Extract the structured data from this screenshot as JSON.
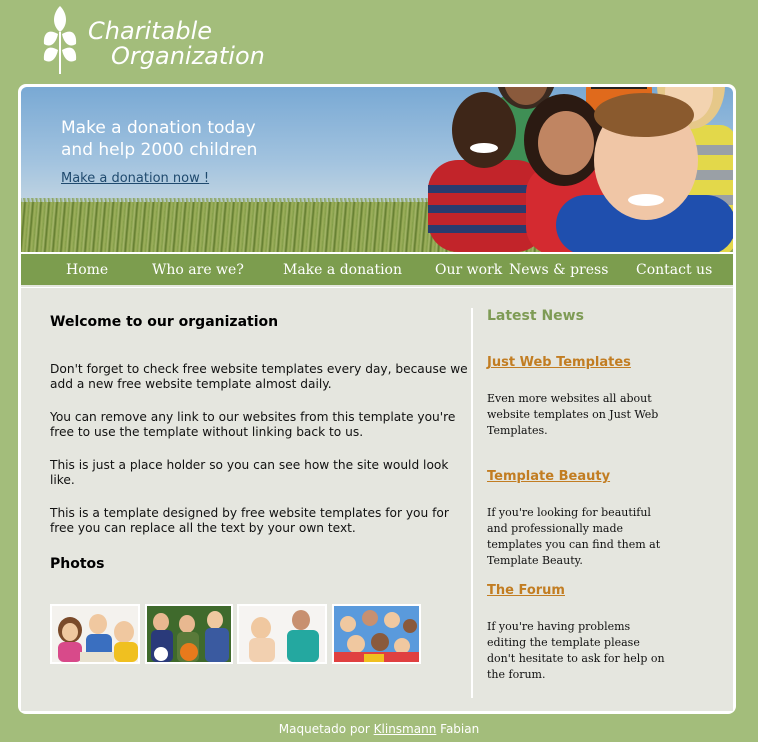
{
  "logo": {
    "line1": "Charitable",
    "line2": "Organization"
  },
  "banner": {
    "tagline_line1": "Make a donation today",
    "tagline_line2": "and help 2000 children",
    "donate_link": "Make a donation now !"
  },
  "nav": {
    "items": [
      "Home",
      "Who are we?",
      "Make a donation",
      "Our work",
      "News & press",
      "Contact us"
    ]
  },
  "main": {
    "welcome_title": "Welcome to our organization",
    "paragraphs": [
      "Don't forget to check free website templates every day, because we add a new free website template almost daily.",
      "You can remove any link to our websites from this template you're free to use the template without linking back to us.",
      "This is just a place holder so you can see how the site would look like.",
      "This is a template designed by free website templates for you for free you can replace all the text by your own text."
    ],
    "photos_title": "Photos"
  },
  "news": {
    "title": "Latest News",
    "items": [
      {
        "heading": "Just Web Templates",
        "body": "Even more websites all about website templates on Just Web Templates."
      },
      {
        "heading": "Template Beauty",
        "body": "If you're looking for beautiful and professionally made templates you can find them at Template Beauty."
      },
      {
        "heading": "The Forum",
        "body": "If you're having problems editing the template please don't hesitate to ask for help on the forum."
      }
    ]
  },
  "footer": {
    "prefix": "Maquetado por",
    "link": "Klinsmann",
    "suffix": "Fabian"
  }
}
